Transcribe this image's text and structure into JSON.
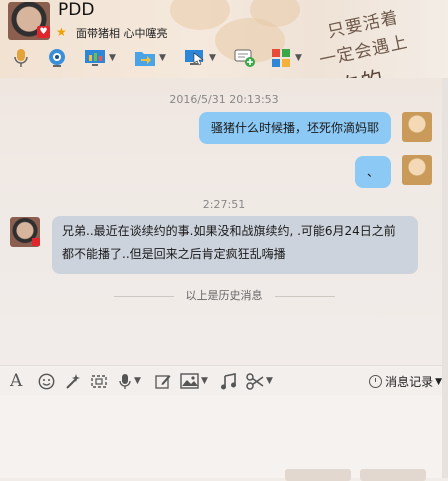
{
  "header": {
    "title": "PDD",
    "signature": "面带猪相 心中噻亮",
    "banner": {
      "line1": "只要活着",
      "line2": "一定会遇上",
      "line3": "好吃的"
    }
  },
  "toolbar": {
    "items": [
      {
        "name": "voice-call-icon"
      },
      {
        "name": "video-call-icon"
      },
      {
        "name": "remote-assist-icon"
      },
      {
        "name": "send-file-icon"
      },
      {
        "name": "screen-share-icon"
      },
      {
        "name": "add-member-icon"
      },
      {
        "name": "apps-icon"
      }
    ]
  },
  "chat": {
    "messages": [
      {
        "timestamp": "2016/5/31 20:13:53"
      },
      {
        "side": "right",
        "text": "骚猪什么时候播，坯死你滴妈耶"
      },
      {
        "side": "right",
        "text": "、"
      },
      {
        "timestamp": "2:27:51"
      },
      {
        "side": "left",
        "text_line1": "兄弟..最近在谈续约的事.如果没和战旗续约, .可能6月24日之前",
        "text_line2": "都不能播了..但是回来之后肯定疯狂乱嗨播"
      }
    ],
    "history_label": "以上是历史消息"
  },
  "input_toolbar": {
    "history_button": "消息记录"
  },
  "colors": {
    "bubble_sent": "#8cc9f5",
    "bubble_received": "#cdd3dc"
  }
}
